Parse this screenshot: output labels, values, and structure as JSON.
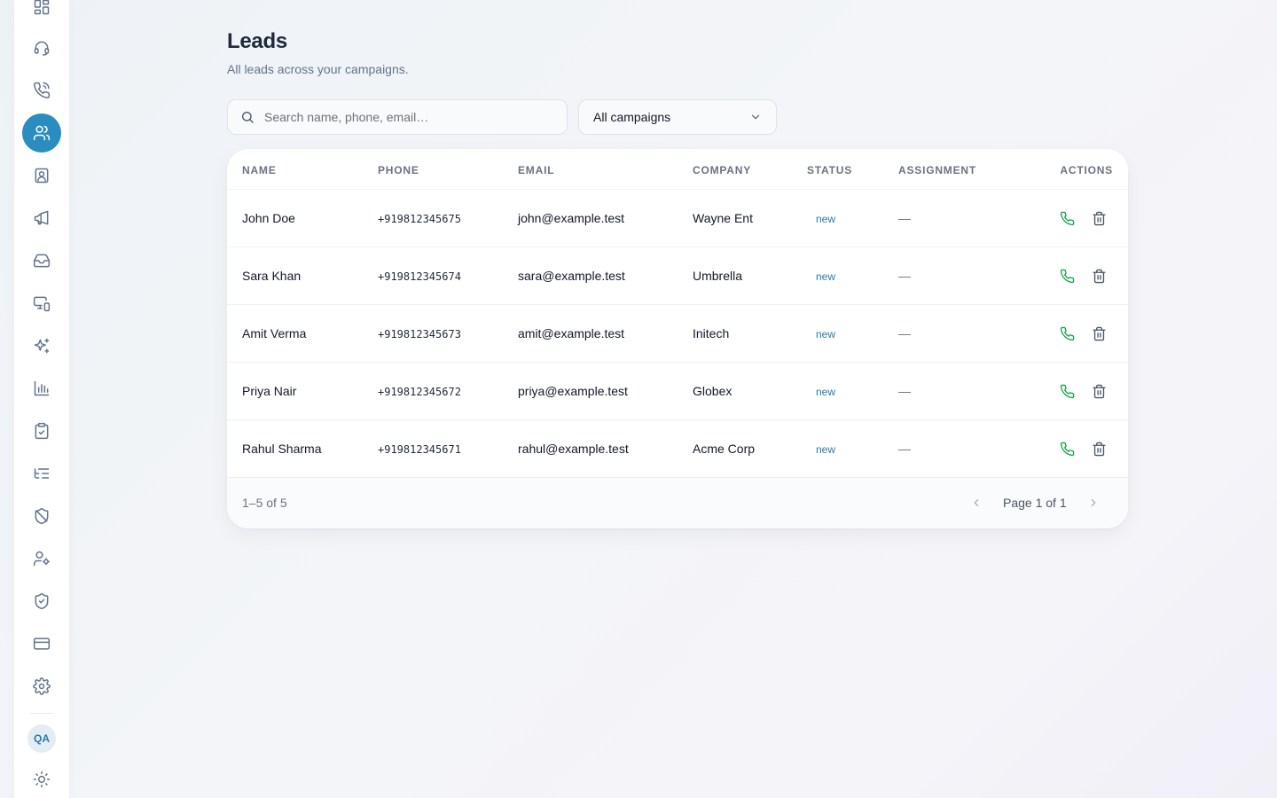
{
  "sidebar": {
    "items": [
      {
        "icon": "dashboard-icon",
        "active": false
      },
      {
        "icon": "headset-icon",
        "active": false
      },
      {
        "icon": "phone-call-icon",
        "active": false
      },
      {
        "icon": "users-icon",
        "active": true
      },
      {
        "icon": "contact-card-icon",
        "active": false
      },
      {
        "icon": "megaphone-icon",
        "active": false
      },
      {
        "icon": "inbox-icon",
        "active": false
      },
      {
        "icon": "devices-icon",
        "active": false
      },
      {
        "icon": "sparkles-icon",
        "active": false
      },
      {
        "icon": "bar-chart-icon",
        "active": false
      },
      {
        "icon": "clipboard-check-icon",
        "active": false
      },
      {
        "icon": "list-tree-icon",
        "active": false
      },
      {
        "icon": "shield-off-icon",
        "active": false
      },
      {
        "icon": "user-cog-icon",
        "active": false
      },
      {
        "icon": "shield-check-icon",
        "active": false
      },
      {
        "icon": "credit-card-icon",
        "active": false
      },
      {
        "icon": "settings-gear-icon",
        "active": false
      }
    ],
    "avatar_initials": "QA",
    "theme_icon": "sun-icon",
    "accent_color": "#2a8cbf"
  },
  "page": {
    "title": "Leads",
    "subtitle": "All leads across your campaigns."
  },
  "filters": {
    "search_placeholder": "Search name, phone, email…",
    "search_value": "",
    "campaign_select": "All campaigns"
  },
  "table": {
    "columns": [
      "NAME",
      "PHONE",
      "EMAIL",
      "COMPANY",
      "STATUS",
      "ASSIGNMENT",
      "ACTIONS"
    ],
    "rows": [
      {
        "name": "John Doe",
        "phone": "+919812345675",
        "email": "john@example.test",
        "company": "Wayne Ent",
        "status": "new",
        "assignment": "—"
      },
      {
        "name": "Sara Khan",
        "phone": "+919812345674",
        "email": "sara@example.test",
        "company": "Umbrella",
        "status": "new",
        "assignment": "—"
      },
      {
        "name": "Amit Verma",
        "phone": "+919812345673",
        "email": "amit@example.test",
        "company": "Initech",
        "status": "new",
        "assignment": "—"
      },
      {
        "name": "Priya Nair",
        "phone": "+919812345672",
        "email": "priya@example.test",
        "company": "Globex",
        "status": "new",
        "assignment": "—"
      },
      {
        "name": "Rahul Sharma",
        "phone": "+919812345671",
        "email": "rahul@example.test",
        "company": "Acme Corp",
        "status": "new",
        "assignment": "—"
      }
    ],
    "status_color": "#2a7aa8",
    "call_color": "#16a34a"
  },
  "pagination": {
    "range": "1–5 of 5",
    "page_label": "Page 1 of 1"
  }
}
